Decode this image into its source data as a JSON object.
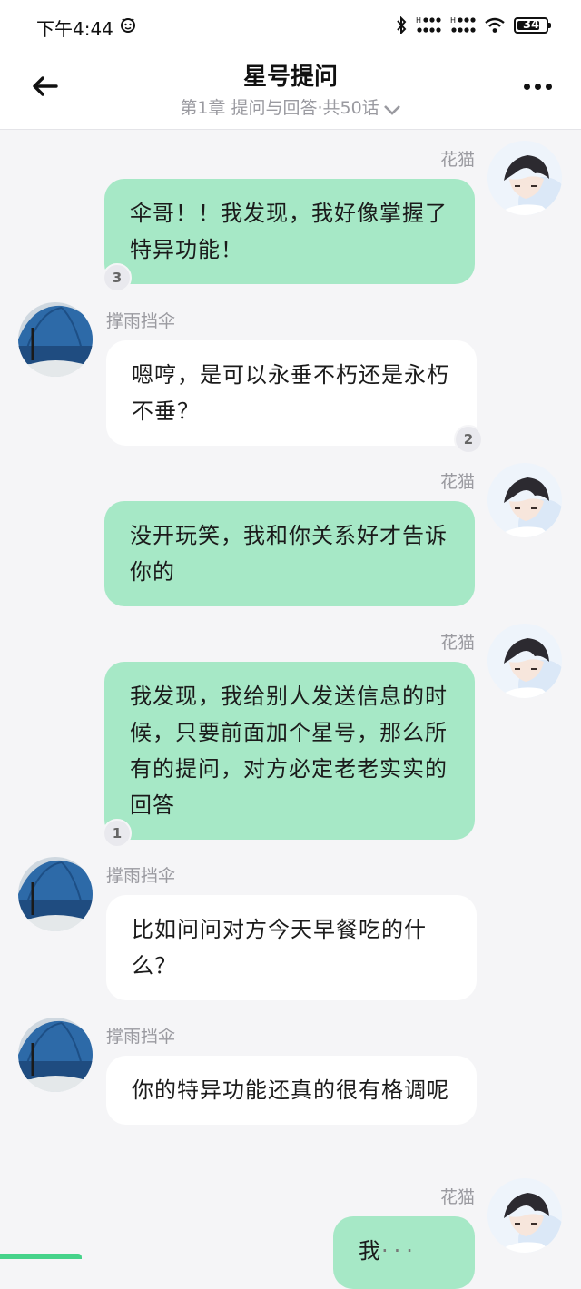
{
  "status_bar": {
    "time": "下午4:44",
    "battery": "34"
  },
  "header": {
    "title": "星号提问",
    "subtitle": "第1章 提问与回答·共50话"
  },
  "messages": [
    {
      "side": "right",
      "name": "花猫",
      "text": "伞哥！！我发现，我好像掌握了特异功能！",
      "badge": "3"
    },
    {
      "side": "left",
      "name": "撑雨挡伞",
      "text": "嗯哼，是可以永垂不朽还是永朽不垂？",
      "badge": "2"
    },
    {
      "side": "right",
      "name": "花猫",
      "text": "没开玩笑，我和你关系好才告诉你的"
    },
    {
      "side": "right",
      "name": "花猫",
      "text": "我发现，我给别人发送信息的时候，只要前面加个星号，那么所有的提问，对方必定老老实实的回答",
      "badge": "1"
    },
    {
      "side": "left",
      "name": "撑雨挡伞",
      "text": "比如问问对方今天早餐吃的什么？"
    },
    {
      "side": "left",
      "name": "撑雨挡伞",
      "text": "你的特异功能还真的很有格调呢"
    },
    {
      "side": "right",
      "name": "花猫",
      "text": "我"
    }
  ],
  "colors": {
    "accent_bubble": "#a6e8c6",
    "background": "#f5f5f7"
  }
}
